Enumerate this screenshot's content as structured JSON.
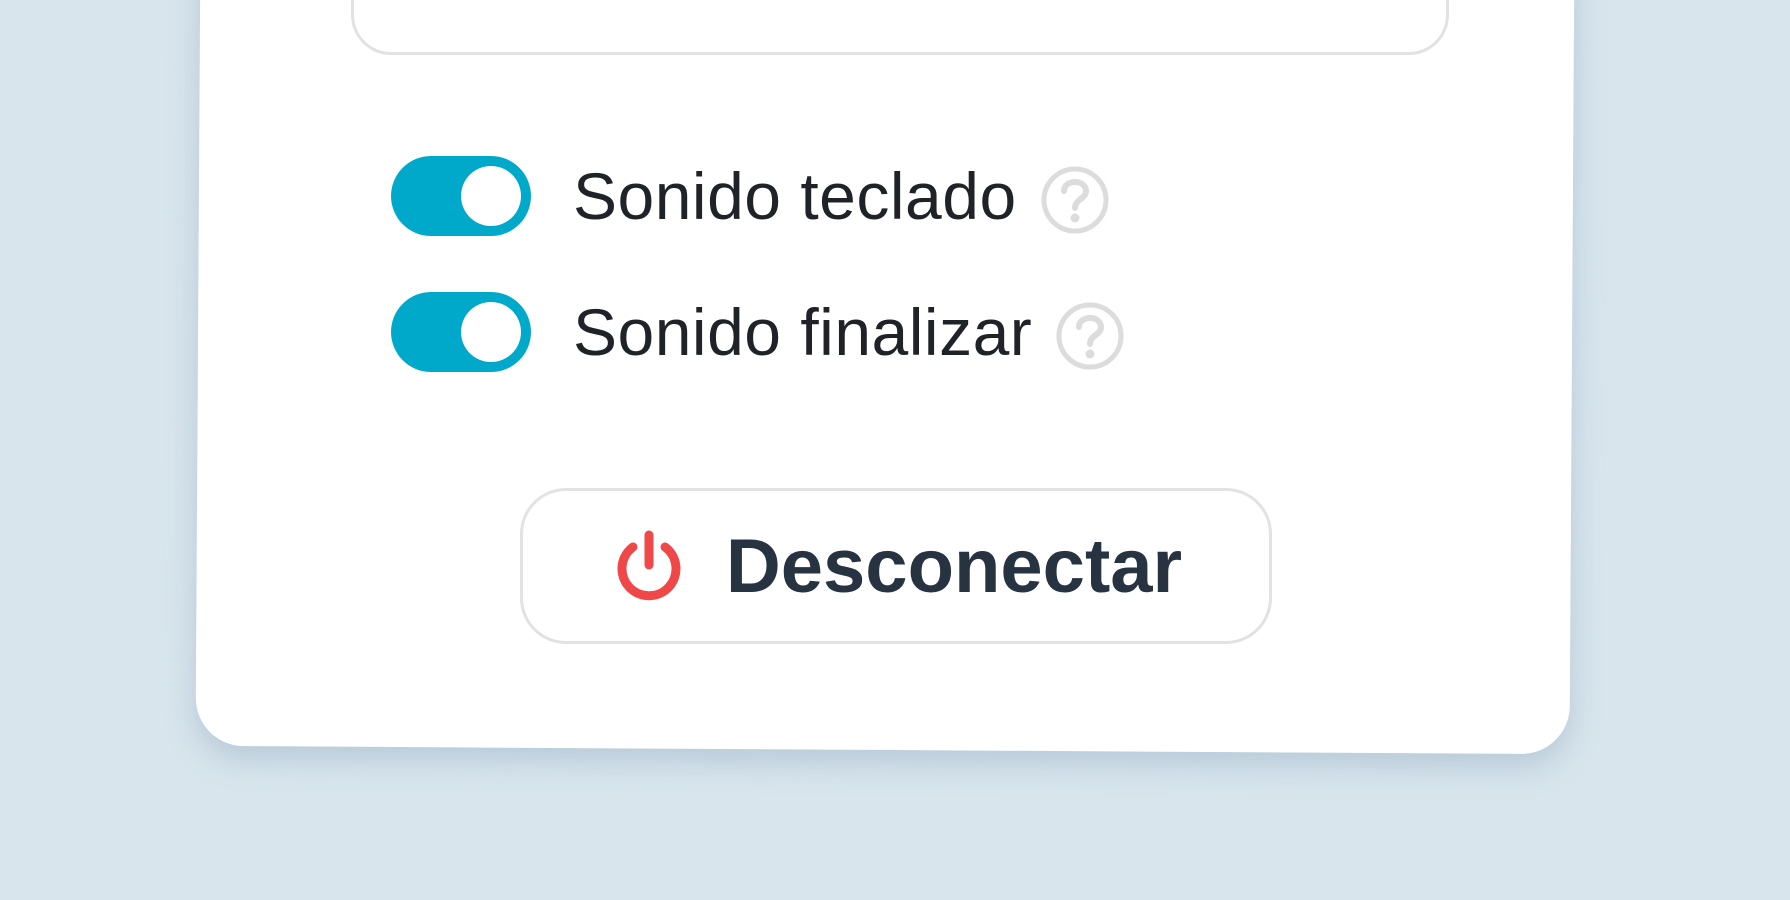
{
  "settings": {
    "toggles": [
      {
        "label": "Sonido teclado",
        "enabled": true
      },
      {
        "label": "Sonido finalizar",
        "enabled": true
      }
    ],
    "disconnect_label": "Desconectar"
  },
  "icons": {
    "help": "question-circle-icon",
    "power": "power-icon"
  },
  "colors": {
    "toggle_on": "#00a9c9",
    "power_icon": "#f04848",
    "background": "#d8e5ed"
  }
}
